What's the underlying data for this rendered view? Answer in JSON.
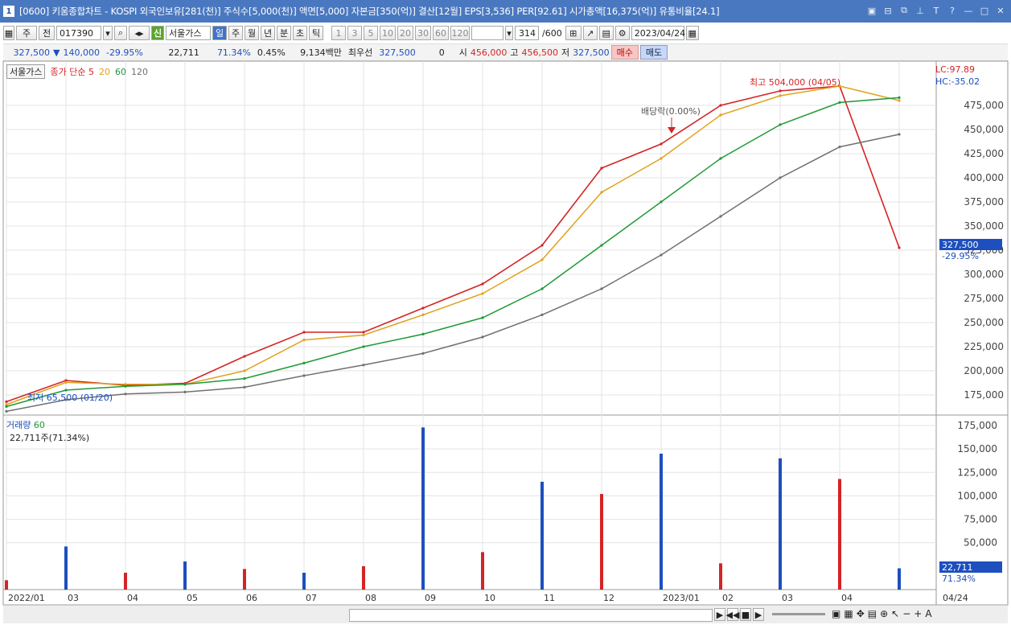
{
  "window": {
    "number": "1",
    "title": "[0600] 키움종합차트 - KOSPI 외국인보유[281(천)] 주식수[5,000(천)] 액면[5,000] 자본금[350(억)] 결산[12월] EPS[3,536] PER[92.61] 시가총액[16,375(억)] 유통비율[24.1]",
    "controls": [
      "▣",
      "⊟",
      "⧉",
      "📌",
      "T",
      "?",
      "—",
      "□",
      "✕"
    ]
  },
  "toolbar": {
    "mode": "주",
    "prev": "전",
    "code": "017390",
    "stock_name": "서울가스",
    "stock_badge": "신",
    "periods": [
      "일",
      "주",
      "월",
      "년",
      "분",
      "초",
      "틱"
    ],
    "active_period": "일",
    "intervals": [
      "1",
      "3",
      "5",
      "10",
      "20",
      "30",
      "60",
      "120"
    ],
    "count": "314",
    "count_total": "/600",
    "date": "2023/04/24"
  },
  "quote": {
    "price": "327,500",
    "change": "140,000",
    "change_pct": "-29.95%",
    "volume": "22,711",
    "volume_pct": "71.34%",
    "turnover": "0.45%",
    "amount": "9,134백만",
    "best_label": "최우선",
    "best_price": "327,500",
    "best_qty": "0",
    "open_label": "시",
    "open": "456,000",
    "high_label": "고",
    "high": "456,500",
    "low_label": "저",
    "low": "327,500",
    "buy": "매수",
    "sell": "매도"
  },
  "legend": {
    "name": "서울가스",
    "price_label": "종가 단순 5",
    "ma20": "20",
    "ma60": "60",
    "ma120": "120",
    "volume_label": "거래량",
    "vol_ma": "60",
    "volume_info": "22,711주(71.34%)"
  },
  "annotations": {
    "high": "최고 504,000 (04/05)",
    "low": "최저 65,500 (01/20)",
    "dividend": "배당락(0.00%)",
    "lc": "LC:97.89",
    "hc": "HC:-35.02",
    "last_price": "327,500",
    "last_pct": "-29.95%",
    "vol_last": "22,711",
    "vol_last_pct": "71.34%"
  },
  "colors": {
    "up": "#d42424",
    "down": "#1d4fbf",
    "ma5": "#d42424",
    "ma20": "#e1a11b",
    "ma60": "#1e9a36",
    "ma120": "#707070",
    "titlebar": "#4a78c0"
  },
  "chart_data": [
    {
      "type": "line",
      "title": "",
      "price_axis": [
        "475,000",
        "450,000",
        "425,000",
        "400,000",
        "375,000",
        "350,000",
        "325,000",
        "300,000",
        "275,000",
        "250,000",
        "225,000",
        "200,000",
        "175,000"
      ],
      "x_axis": [
        "2022/01",
        "03",
        "04",
        "05",
        "06",
        "07",
        "08",
        "09",
        "10",
        "11",
        "12",
        "2023/01",
        "02",
        "03",
        "04",
        "04/24"
      ],
      "series": [
        {
          "name": "종가 단순 5",
          "x": [
            "2022/01",
            "03",
            "04",
            "05",
            "06",
            "07",
            "08",
            "09",
            "10",
            "11",
            "12",
            "2023/01",
            "02",
            "03",
            "04",
            "04/24"
          ],
          "values": [
            168000,
            190000,
            185000,
            187000,
            215000,
            240000,
            240000,
            265000,
            290000,
            330000,
            410000,
            435000,
            475000,
            490000,
            495000,
            327500
          ]
        },
        {
          "name": "20",
          "x": [
            "2022/01",
            "03",
            "04",
            "05",
            "06",
            "07",
            "08",
            "09",
            "10",
            "11",
            "12",
            "2023/01",
            "02",
            "03",
            "04",
            "04/24"
          ],
          "values": [
            165000,
            188000,
            186000,
            186000,
            200000,
            232000,
            237000,
            258000,
            280000,
            315000,
            385000,
            420000,
            465000,
            485000,
            495000,
            480000
          ]
        },
        {
          "name": "60",
          "x": [
            "2022/01",
            "03",
            "04",
            "05",
            "06",
            "07",
            "08",
            "09",
            "10",
            "11",
            "12",
            "2023/01",
            "02",
            "03",
            "04",
            "04/24"
          ],
          "values": [
            163000,
            180000,
            184000,
            186000,
            192000,
            208000,
            225000,
            238000,
            255000,
            285000,
            330000,
            375000,
            420000,
            455000,
            478000,
            483000
          ]
        },
        {
          "name": "120",
          "x": [
            "2022/01",
            "03",
            "04",
            "05",
            "06",
            "07",
            "08",
            "09",
            "10",
            "11",
            "12",
            "2023/01",
            "02",
            "03",
            "04",
            "04/24"
          ],
          "values": [
            158000,
            170000,
            176000,
            178000,
            183000,
            195000,
            206000,
            218000,
            235000,
            258000,
            285000,
            320000,
            360000,
            400000,
            432000,
            445000
          ]
        }
      ]
    },
    {
      "type": "bar",
      "title": "",
      "volume_axis": [
        "175,000",
        "150,000",
        "125,000",
        "100,000",
        "75,000",
        "50,000"
      ],
      "series": [
        {
          "name": "거래량",
          "x": [
            "2022/01",
            "03",
            "04",
            "05",
            "06",
            "07",
            "08",
            "09",
            "10",
            "11",
            "12",
            "2023/01",
            "02",
            "03",
            "04",
            "04/24"
          ],
          "values": [
            10000,
            46000,
            18000,
            30000,
            22000,
            18000,
            25000,
            173000,
            40000,
            115000,
            102000,
            145000,
            28000,
            140000,
            118000,
            22711
          ]
        }
      ],
      "ylim": [
        0,
        175000
      ]
    }
  ]
}
